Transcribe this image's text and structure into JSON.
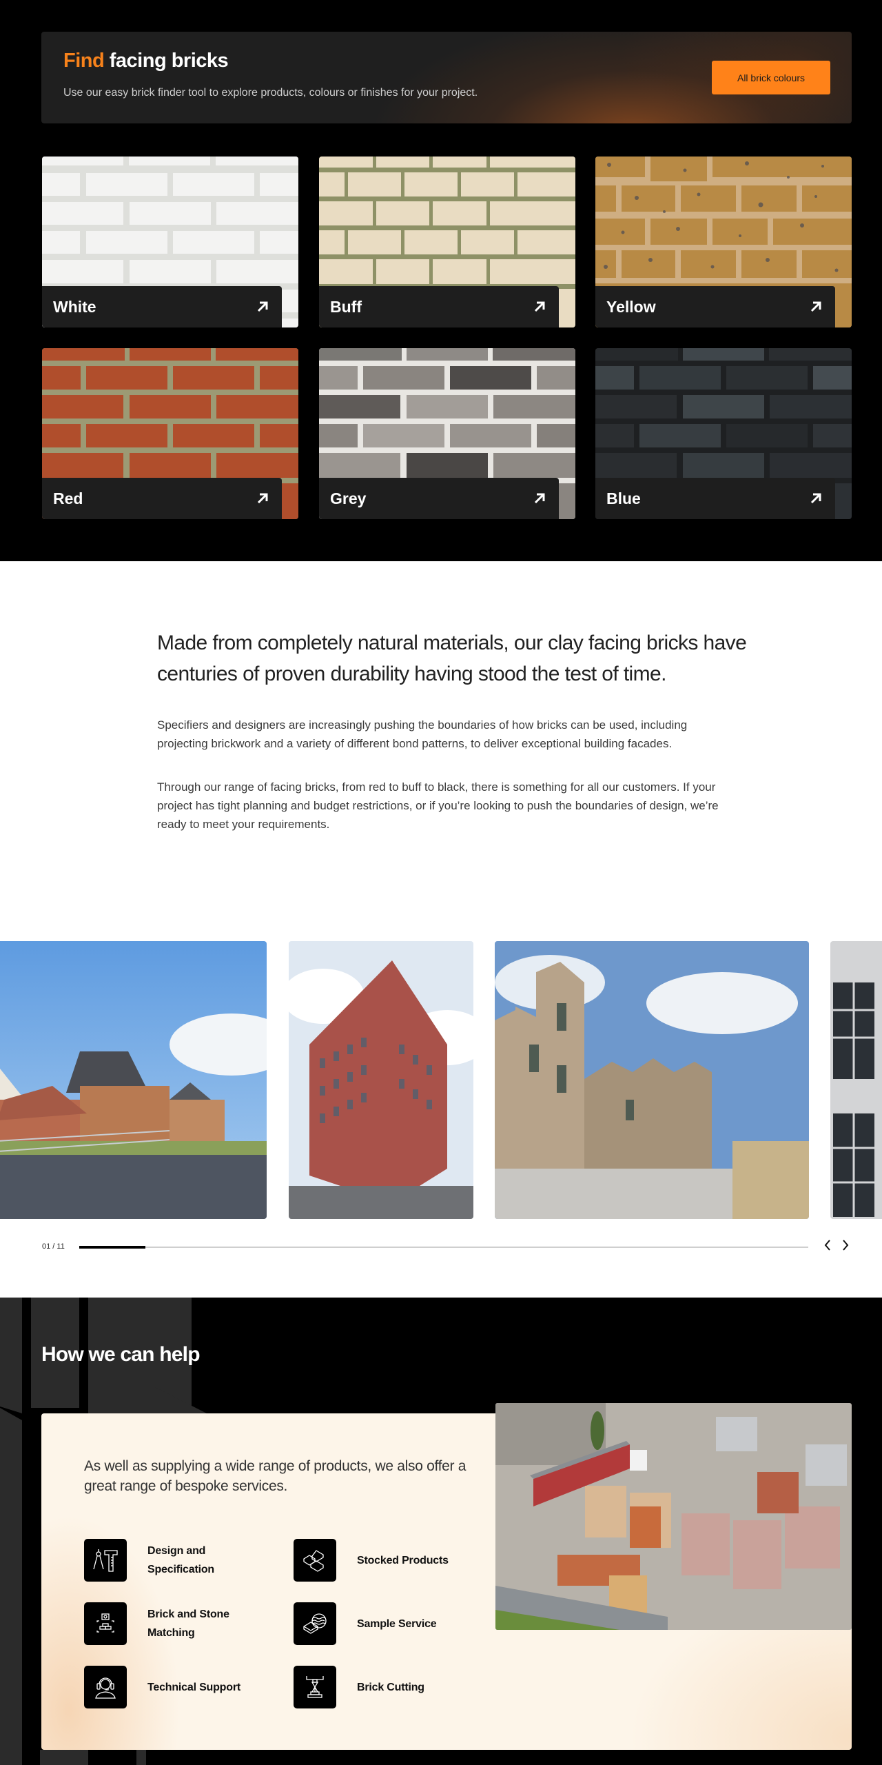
{
  "finder": {
    "title_accent": "Find",
    "title_rest": "facing bricks",
    "subtitle": "Use our easy brick finder tool to explore products, colours or finishes for your project.",
    "button_label": "All brick colours",
    "accent_color": "#f7821b",
    "tiles": [
      {
        "label": "White",
        "icon": "arrow-up-right-icon"
      },
      {
        "label": "Buff",
        "icon": "arrow-up-right-icon"
      },
      {
        "label": "Yellow",
        "icon": "arrow-up-right-icon"
      },
      {
        "label": "Red",
        "icon": "arrow-up-right-icon"
      },
      {
        "label": "Grey",
        "icon": "arrow-up-right-icon"
      },
      {
        "label": "Blue",
        "icon": "arrow-up-right-icon"
      }
    ]
  },
  "about": {
    "lead": "Made from completely natural materials, our clay facing bricks have centuries of proven durability having stood the test of time.",
    "paragraphs": [
      "Specifiers and designers are increasingly pushing the boundaries of how bricks can be used, including projecting brickwork and a variety of different bond patterns, to deliver exceptional building facades.",
      "Through our range of facing bricks, from red to buff to black, there is something for all our customers. If your project has tight planning and budget restrictions, or if you’re looking to push the boundaries of design, we’re ready to meet your requirements."
    ]
  },
  "carousel": {
    "slides": [
      {
        "alt": "Red brick suburban houses"
      },
      {
        "alt": "Red brick apartment tower"
      },
      {
        "alt": "Buff brick terraced buildings with arches"
      },
      {
        "alt": "Grey brick building with windows"
      }
    ],
    "counter": "01 / 11",
    "current": 1,
    "total": 11,
    "prev_icon": "chevron-left-icon",
    "next_icon": "chevron-right-icon"
  },
  "help": {
    "title": "How we can help",
    "lead": "As well as supplying a wide range of products, we also offer a great range of bespoke services.",
    "services": [
      {
        "label": "Design and Specification",
        "icon": "compass-ruler-icon"
      },
      {
        "label": "Stocked Products",
        "icon": "stacked-bricks-icon"
      },
      {
        "label": "Brick and Stone Matching",
        "icon": "camera-brick-icon"
      },
      {
        "label": "Sample Service",
        "icon": "brick-sample-icon"
      },
      {
        "label": "Technical Support",
        "icon": "headset-icon"
      },
      {
        "label": "Brick Cutting",
        "icon": "brick-cutter-icon"
      }
    ],
    "photo_alt": "Aerial view of brick stockyard with lorry"
  }
}
